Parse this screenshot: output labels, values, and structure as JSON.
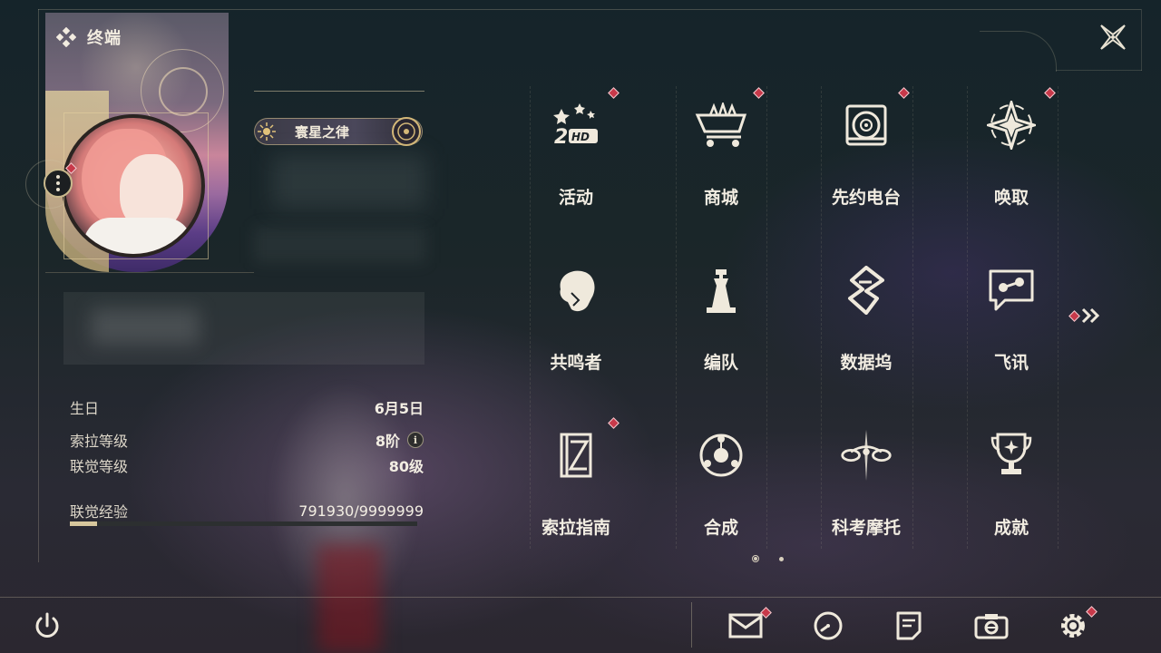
{
  "app": {
    "title": "终端"
  },
  "profile": {
    "nameplate": "寰星之律",
    "info": [
      {
        "label": "生日",
        "value": "6月5日"
      },
      {
        "label": "索拉等级",
        "value": "8阶"
      },
      {
        "label": "联觉等级",
        "value": "80级"
      },
      {
        "label": "联觉经验",
        "value": "791930/9999999"
      }
    ],
    "exp_fraction": 0.0792
  },
  "grid": {
    "items": [
      {
        "label": "活动",
        "icon": "event-2hd-icon",
        "badge": true
      },
      {
        "label": "商城",
        "icon": "shop-cart-icon",
        "badge": true
      },
      {
        "label": "先约电台",
        "icon": "radio-disc-icon",
        "badge": true
      },
      {
        "label": "唤取",
        "icon": "convene-star-icon",
        "badge": true
      },
      {
        "label": "共鸣者",
        "icon": "resonator-head-icon",
        "badge": false
      },
      {
        "label": "编队",
        "icon": "team-chess-icon",
        "badge": false
      },
      {
        "label": "数据坞",
        "icon": "data-dock-icon",
        "badge": false
      },
      {
        "label": "飞讯",
        "icon": "chat-message-icon",
        "badge": false
      },
      {
        "label": "索拉指南",
        "icon": "guide-book-icon",
        "badge": true
      },
      {
        "label": "合成",
        "icon": "synthesis-icon",
        "badge": false
      },
      {
        "label": "科考摩托",
        "icon": "motorbike-icon",
        "badge": false
      },
      {
        "label": "成就",
        "icon": "trophy-icon",
        "badge": false
      }
    ],
    "pages": 2,
    "current_page": 1
  },
  "colors": {
    "accent": "#d7c79d",
    "badge": "#c8394a",
    "text": "#f2ede2"
  },
  "bottom": {
    "icons": [
      "power-icon",
      "mail-icon",
      "clock-icon",
      "notice-icon",
      "camera-icon",
      "settings-icon"
    ]
  }
}
